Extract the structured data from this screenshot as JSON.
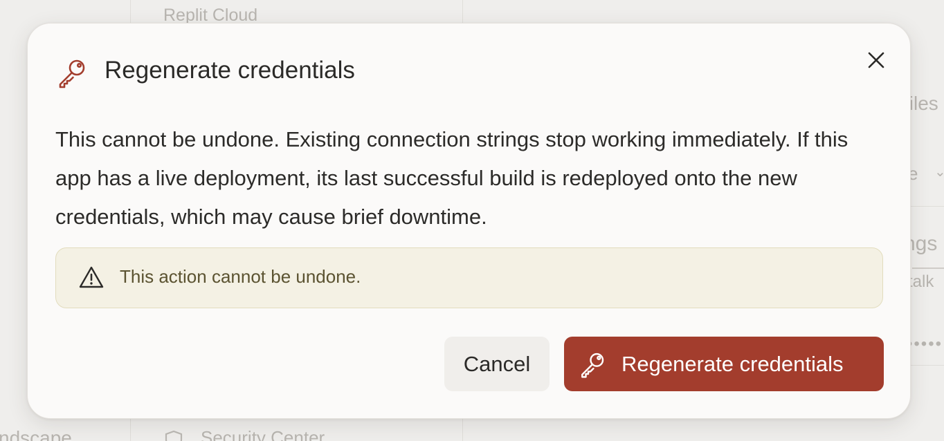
{
  "background": {
    "top_label": "Replit Cloud",
    "right_fragment_files": "files",
    "right_fragment_e": "e",
    "right_chevron": "⌄",
    "right_fragment_ngs": "ngs",
    "right_fragment_talk": "talk",
    "right_fragment_dots": "•••••",
    "bottom_left_fragment": "ndscape",
    "bottom_security": "Security Center"
  },
  "dialog": {
    "title": "Regenerate credentials",
    "title_icon": "key-icon",
    "close_icon": "close-icon",
    "body": "This cannot be undone. Existing connection strings stop working immediately. If this app has a live deployment, its last successful build is redeployed onto the new credentials, which may cause brief downtime.",
    "warning": {
      "icon": "warning-triangle-icon",
      "text": "This action cannot be undone."
    },
    "buttons": {
      "cancel_label": "Cancel",
      "confirm_label": "Regenerate credentials",
      "confirm_icon": "key-icon"
    }
  },
  "colors": {
    "accent": "#a33d2d",
    "warning_bg": "#f4f1e4",
    "warning_border": "#e2dcbd",
    "warning_text": "#5b5331"
  }
}
